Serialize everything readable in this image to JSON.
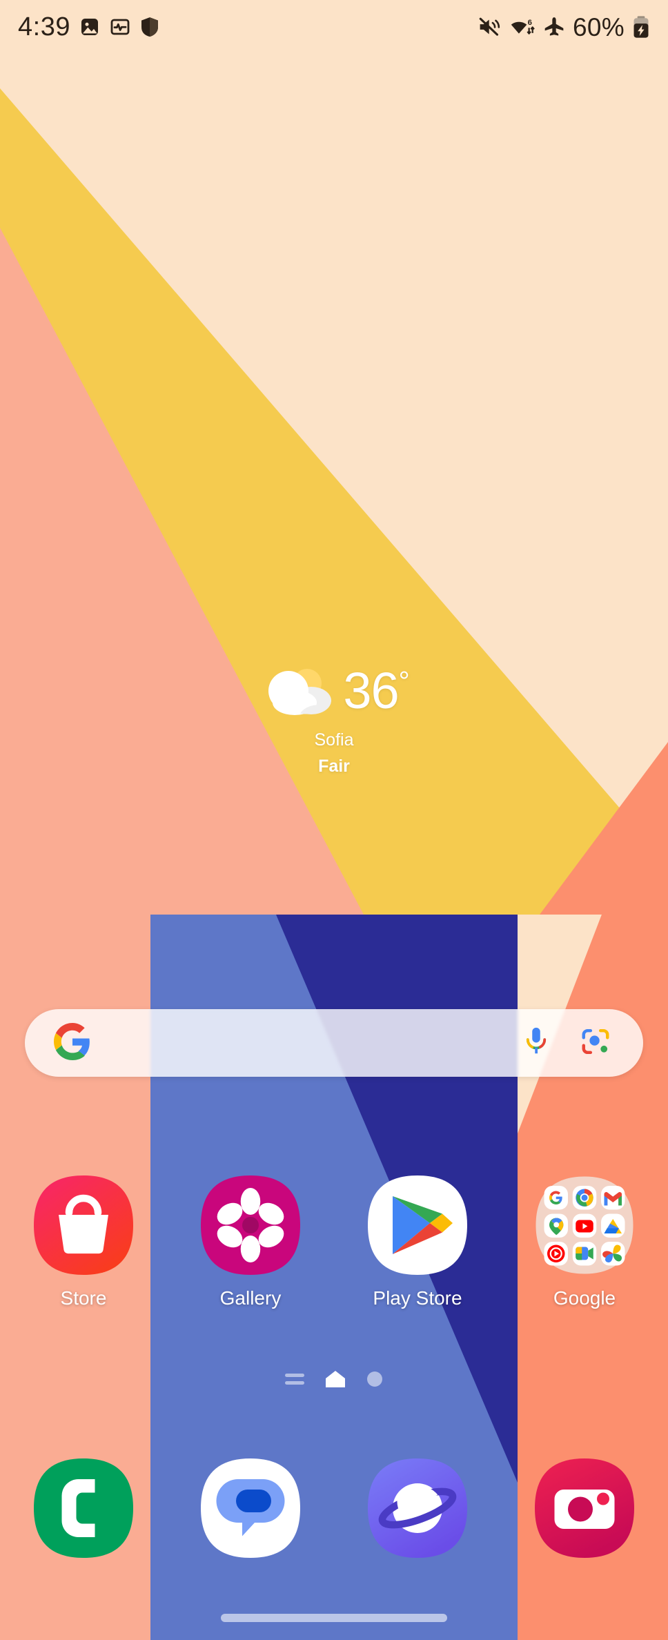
{
  "status_bar": {
    "time": "4:39",
    "battery_percent": "60%",
    "left_icons": [
      "photo-icon",
      "health-monitor-icon",
      "shield-icon"
    ],
    "right_icons": [
      "mute-icon",
      "wifi-6-icon",
      "airplane-mode-icon",
      "battery-charging-icon"
    ]
  },
  "weather": {
    "icon": "partly-cloudy-icon",
    "temperature": "36",
    "degree": "°",
    "city": "Sofia",
    "condition": "Fair"
  },
  "search": {
    "placeholder": "",
    "value": "",
    "google_icon": "google-g-icon",
    "mic_icon": "microphone-icon",
    "lens_icon": "google-lens-icon"
  },
  "apps": [
    {
      "label": "Store",
      "icon": "galaxy-store-icon"
    },
    {
      "label": "Gallery",
      "icon": "gallery-icon"
    },
    {
      "label": "Play Store",
      "icon": "play-store-icon"
    },
    {
      "label": "Google",
      "icon": "google-folder-icon"
    }
  ],
  "google_folder_apps": [
    "google-search-icon",
    "chrome-icon",
    "gmail-icon",
    "maps-icon",
    "youtube-icon",
    "drive-icon",
    "youtube-music-icon",
    "meet-icon",
    "photos-icon"
  ],
  "page_indicator": {
    "items": [
      "list-page-icon",
      "home-page-icon",
      "dot-page-icon"
    ],
    "active_index": 1
  },
  "dock": [
    {
      "label": "Phone",
      "icon": "phone-icon"
    },
    {
      "label": "Messages",
      "icon": "messages-icon"
    },
    {
      "label": "Internet",
      "icon": "samsung-internet-icon"
    },
    {
      "label": "Camera",
      "icon": "camera-icon"
    }
  ],
  "navigation": {
    "gesture_handle": "gesture-bar-handle"
  },
  "colors": {
    "wallpaper_cream": "#FCE3C8",
    "wallpaper_yellow": "#F5CB4F",
    "wallpaper_salmon": "#FAAC93",
    "wallpaper_coral": "#FC8F6E",
    "wallpaper_navy": "#2B2C95",
    "wallpaper_periwinkle": "#627BCD",
    "status_text": "#2B2118",
    "label_text": "#FFFFFF"
  }
}
